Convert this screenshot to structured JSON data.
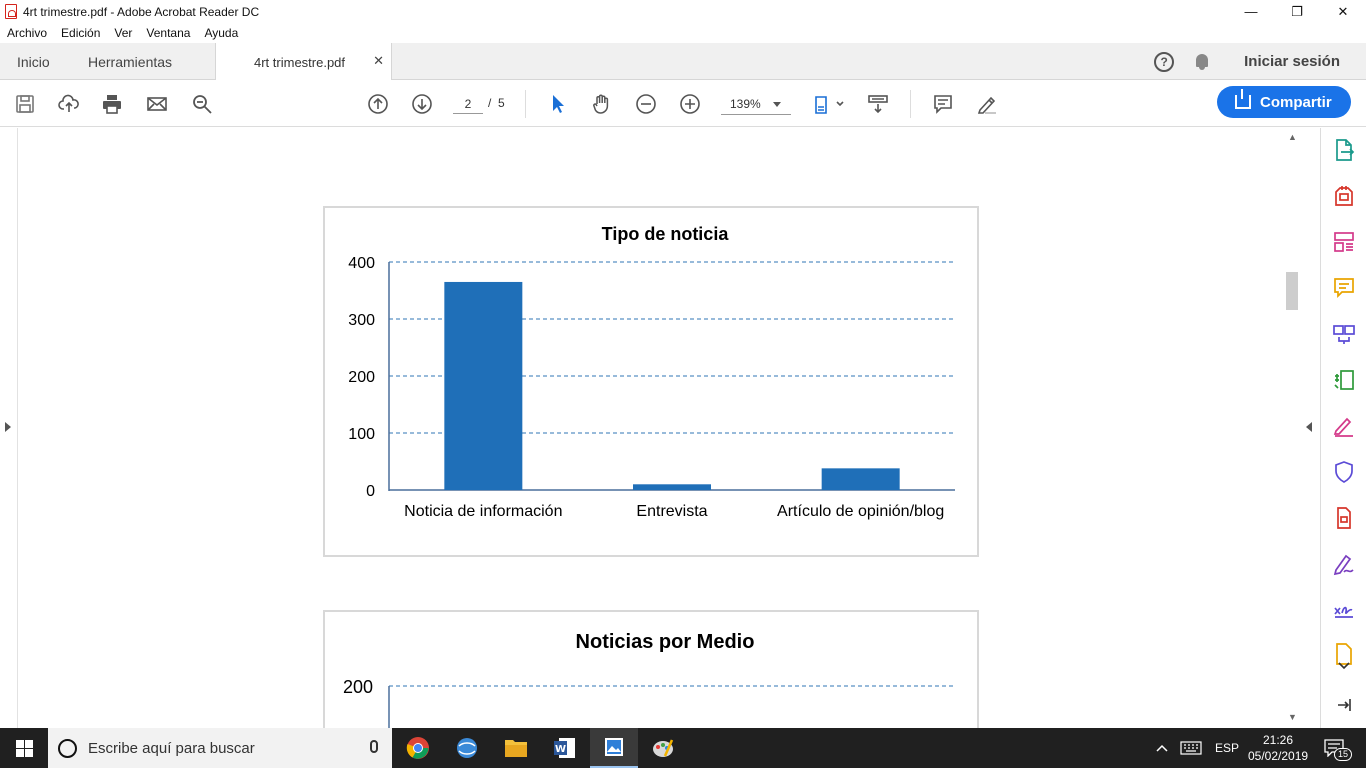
{
  "window": {
    "title": "4rt trimestre.pdf - Adobe Acrobat Reader DC",
    "minimize_glyph": "—",
    "maximize_glyph": "❐",
    "close_glyph": "✕"
  },
  "menubar": {
    "items": [
      "Archivo",
      "Edición",
      "Ver",
      "Ventana",
      "Ayuda"
    ]
  },
  "tabs": {
    "home": "Inicio",
    "tools": "Herramientas",
    "document": "4rt trimestre.pdf",
    "document_close_glyph": "✕",
    "signin": "Iniciar sesión",
    "help_glyph": "?"
  },
  "toolbar": {
    "page_current": "2",
    "page_separator": "/",
    "page_total": "5",
    "zoom": "139%",
    "share_label": "Compartir"
  },
  "colors": {
    "bar": "#1f6fb8",
    "gridline": "#2f74b5",
    "share": "#1a73e8",
    "taskbar": "#202020"
  },
  "chart_data": [
    {
      "type": "bar",
      "title": "Tipo de noticia",
      "categories": [
        "Noticia de información",
        "Entrevista",
        "Artículo de opinión/blog"
      ],
      "values": [
        365,
        10,
        38
      ],
      "ylim": [
        0,
        400
      ],
      "yticks": [
        "0",
        "100",
        "200",
        "300",
        "400"
      ],
      "grid": true
    },
    {
      "type": "bar",
      "title": "Noticias por Medio",
      "visible_yticks": [
        "200"
      ],
      "grid": true
    }
  ],
  "taskbar": {
    "search_placeholder": "Escribe aquí para buscar",
    "language": "ESP",
    "time": "21:26",
    "date": "05/02/2019",
    "notifications_count": "15"
  }
}
